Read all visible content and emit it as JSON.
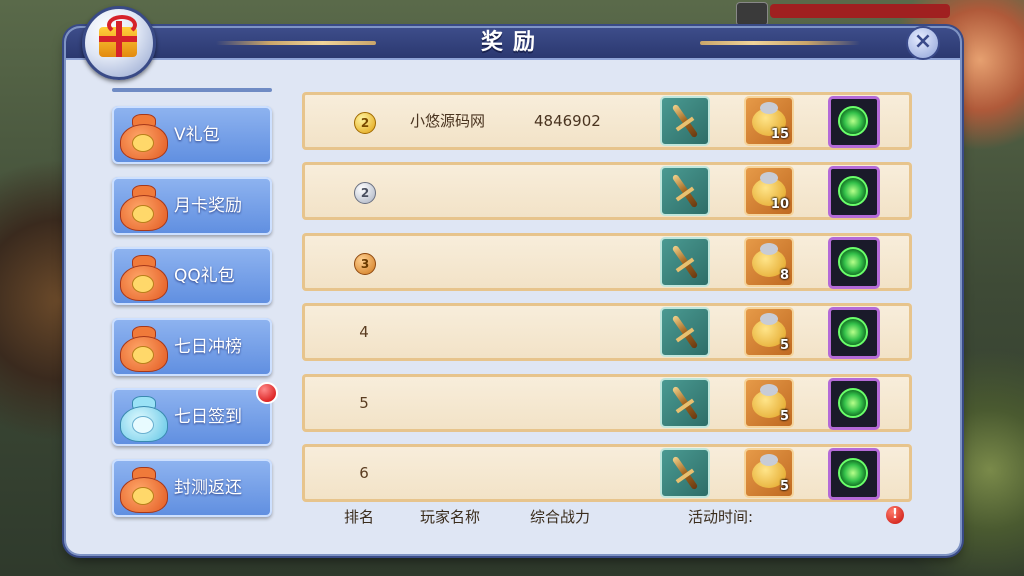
{
  "dialog": {
    "title": "奖励",
    "close_glyph": "×"
  },
  "sidebar": {
    "items": [
      {
        "label": "V礼包",
        "icon": "orange-bag-icon",
        "badge": false
      },
      {
        "label": "月卡奖励",
        "icon": "orange-bag-icon",
        "badge": false
      },
      {
        "label": "QQ礼包",
        "icon": "orange-bag-icon",
        "badge": false
      },
      {
        "label": "七日冲榜",
        "icon": "orange-bag-icon",
        "badge": false
      },
      {
        "label": "七日签到",
        "icon": "blue-bag-icon",
        "badge": true
      },
      {
        "label": "封测返还",
        "icon": "orange-bag-icon",
        "badge": false
      }
    ]
  },
  "rewards": {
    "rows": [
      {
        "rank": "2",
        "medal": "gold",
        "player": "小悠源码网",
        "power": "4846902",
        "money_qty": "15"
      },
      {
        "rank": "2",
        "medal": "silver",
        "player": "",
        "power": "",
        "money_qty": "10"
      },
      {
        "rank": "3",
        "medal": "bronze",
        "player": "",
        "power": "",
        "money_qty": "8"
      },
      {
        "rank": "4",
        "medal": "",
        "player": "",
        "power": "",
        "money_qty": "5"
      },
      {
        "rank": "5",
        "medal": "",
        "player": "",
        "power": "",
        "money_qty": "5"
      },
      {
        "rank": "6",
        "medal": "",
        "player": "",
        "power": "",
        "money_qty": "5"
      }
    ]
  },
  "footer": {
    "rank_label": "排名",
    "player_label": "玩家名称",
    "power_label": "综合战力",
    "time_label": "活动时间:",
    "warn_glyph": "!"
  },
  "colors": {
    "panel": "#dfe6f4",
    "titlebar": "#2b3870",
    "tab": "#6f9be6",
    "row": "#f4e6cc"
  }
}
